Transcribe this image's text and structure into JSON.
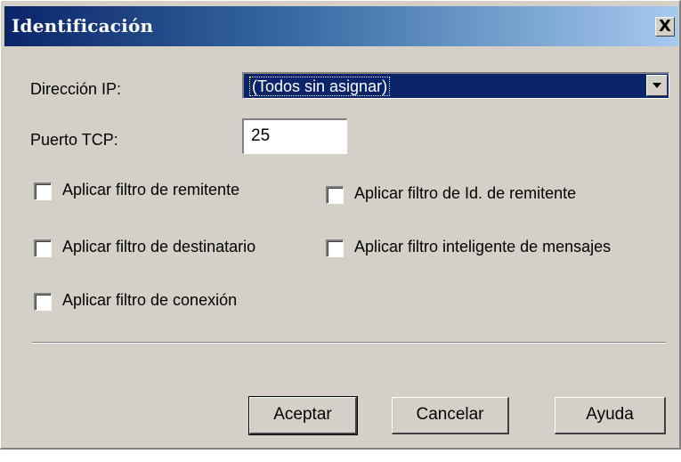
{
  "window": {
    "title": "Identificación",
    "close_label": "X"
  },
  "form": {
    "ip_label": "Dirección IP:",
    "ip_value": "(Todos sin asignar)",
    "port_label": "Puerto TCP:",
    "port_value": "25"
  },
  "checkboxes": [
    {
      "label": "Aplicar filtro de remitente",
      "checked": false
    },
    {
      "label": "Aplicar filtro de Id. de remitente",
      "checked": false
    },
    {
      "label": "Aplicar filtro de destinatario",
      "checked": false
    },
    {
      "label": "Aplicar filtro inteligente de mensajes",
      "checked": false
    },
    {
      "label": "Aplicar filtro de conexión",
      "checked": false
    }
  ],
  "buttons": {
    "ok": "Aceptar",
    "cancel": "Cancelar",
    "help": "Ayuda"
  },
  "colors": {
    "dialog_bg": "#d4d0c8",
    "title_start": "#0a246a",
    "title_end": "#a6caf0",
    "selection": "#0a246a"
  },
  "icons": [
    "close-icon",
    "dropdown-arrow-icon"
  ]
}
